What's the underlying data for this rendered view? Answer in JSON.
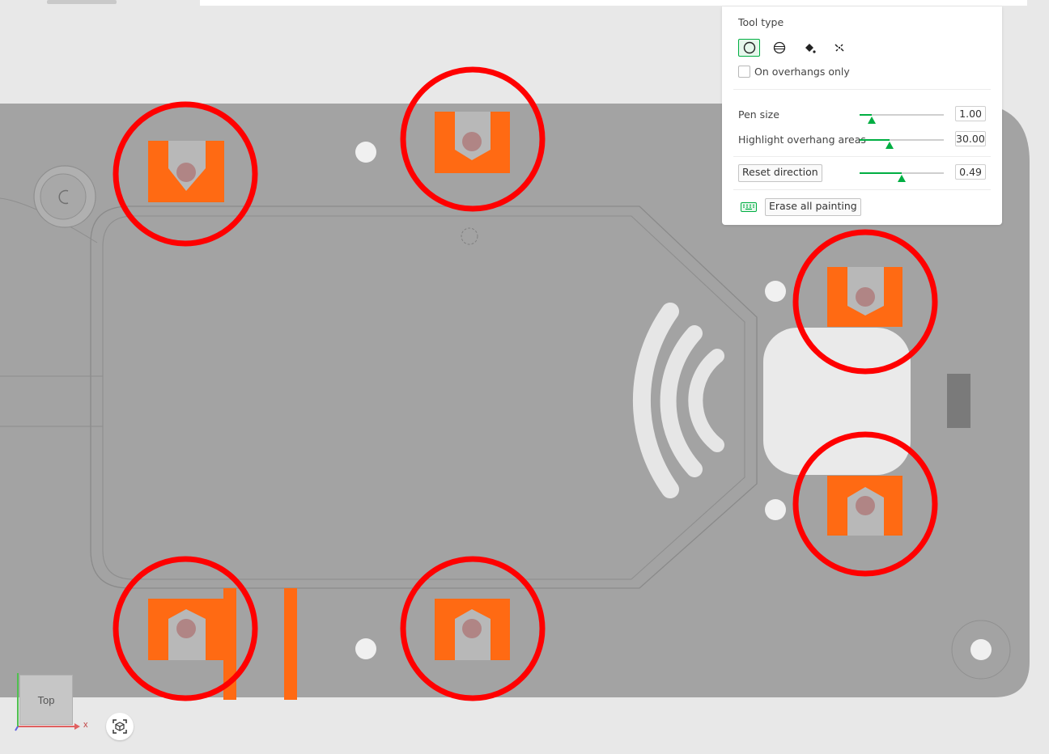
{
  "panel": {
    "tool_type_label": "Tool type",
    "tools": [
      {
        "icon": "circle-brush-icon",
        "active": true
      },
      {
        "icon": "sphere-brush-icon",
        "active": false
      },
      {
        "icon": "fill-bucket-icon",
        "active": false
      },
      {
        "icon": "gap-fill-icon",
        "active": false
      }
    ],
    "overhangs_only_label": "On overhangs only",
    "overhangs_only_checked": false,
    "pen_size": {
      "label": "Pen size",
      "value": "1.00",
      "fraction": 0.14
    },
    "highlight_overhang": {
      "label": "Highlight overhang areas",
      "value": "30.00",
      "fraction": 0.36
    },
    "reset_direction": {
      "label": "Reset direction",
      "value": "0.49",
      "fraction": 0.5
    },
    "erase_label": "Erase all painting",
    "erase_icon": "keyboard-icon"
  },
  "viewport": {
    "view_cube_label": "Top",
    "axis_x_label": "x",
    "fit_icon": "fit-view-icon",
    "colors": {
      "plate": "#a3a3a3",
      "painted": "#ff6a13",
      "highlight_circle": "#ff0000",
      "hole": "#f0f0f0",
      "accent": "#00ae42"
    }
  }
}
